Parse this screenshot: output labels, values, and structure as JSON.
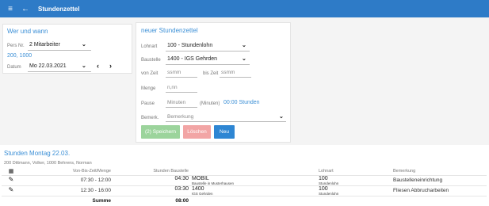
{
  "header": {
    "title": "Stundenzettel"
  },
  "left_card": {
    "title": "Wer und wann",
    "pers_label": "Pers Nr.",
    "pers_value": "2 Mitarbeiter",
    "ids": "200, 1000",
    "date_label": "Datum",
    "date_value": "Mo 22.03.2021"
  },
  "right_card": {
    "title": "neuer Stundenzettel",
    "lohnart_label": "Lohnart",
    "lohnart_value": "100 - Stundenlohn",
    "baustelle_label": "Baustelle",
    "baustelle_value": "1400 - IGS Gehrden",
    "von_label": "von Zeit",
    "von_placeholder": "ssmm",
    "bis_label": "bis Zeit",
    "bis_placeholder": "ssmm",
    "menge_label": "Menge",
    "menge_placeholder": "n,nn",
    "pause_label": "Pause",
    "pause_placeholder": "Minuten",
    "pause_unit": "(Minuten)",
    "pause_total": "00:00 Stunden",
    "bemerk_label": "Bemerk.",
    "bemerk_value": "Bemerkung",
    "btn_save": "(2) Speichern",
    "btn_delete": "Löschen",
    "btn_new": "Neu"
  },
  "summary": {
    "title": "Stunden Montag 22.03.",
    "persons": "200 Dittmann, Volker, 1000 Behrens, Norman",
    "columns": {
      "icon": "▦",
      "time": "Von-Bis-Zeit/Menge",
      "stunden": "Stunden Baustelle",
      "lohnart": "Lohnart",
      "bemerkung": "Bemerkung"
    },
    "rows": [
      {
        "time": "07:30 - 12:00",
        "stunden": "04:30",
        "baustelle_code": "MOBIL",
        "baustelle_name": "Baustelle in Musterhausen",
        "lohnart_code": "100",
        "lohnart_name": "Stundenlohn",
        "bemerkung": "Baustelleneinrichtung"
      },
      {
        "time": "12:30 - 16:00",
        "stunden": "03:30",
        "baustelle_code": "1400",
        "baustelle_name": "IGS Gehrden",
        "lohnart_code": "100",
        "lohnart_name": "Stundenlohn",
        "bemerkung": "Fliesen Abbrucharbeiten"
      }
    ],
    "sum_label": "Summe",
    "sum_value": "08:00"
  },
  "colors": {
    "accent": "#2e7bc7",
    "link": "#3b8fd6",
    "save": "#9cd49c",
    "delete": "#f2a5a5",
    "new": "#2e86d3"
  },
  "icons": {
    "menu": "hamburger-icon",
    "back": "back-arrow-icon",
    "edit": "pencil-icon",
    "grid": "grid-icon"
  }
}
